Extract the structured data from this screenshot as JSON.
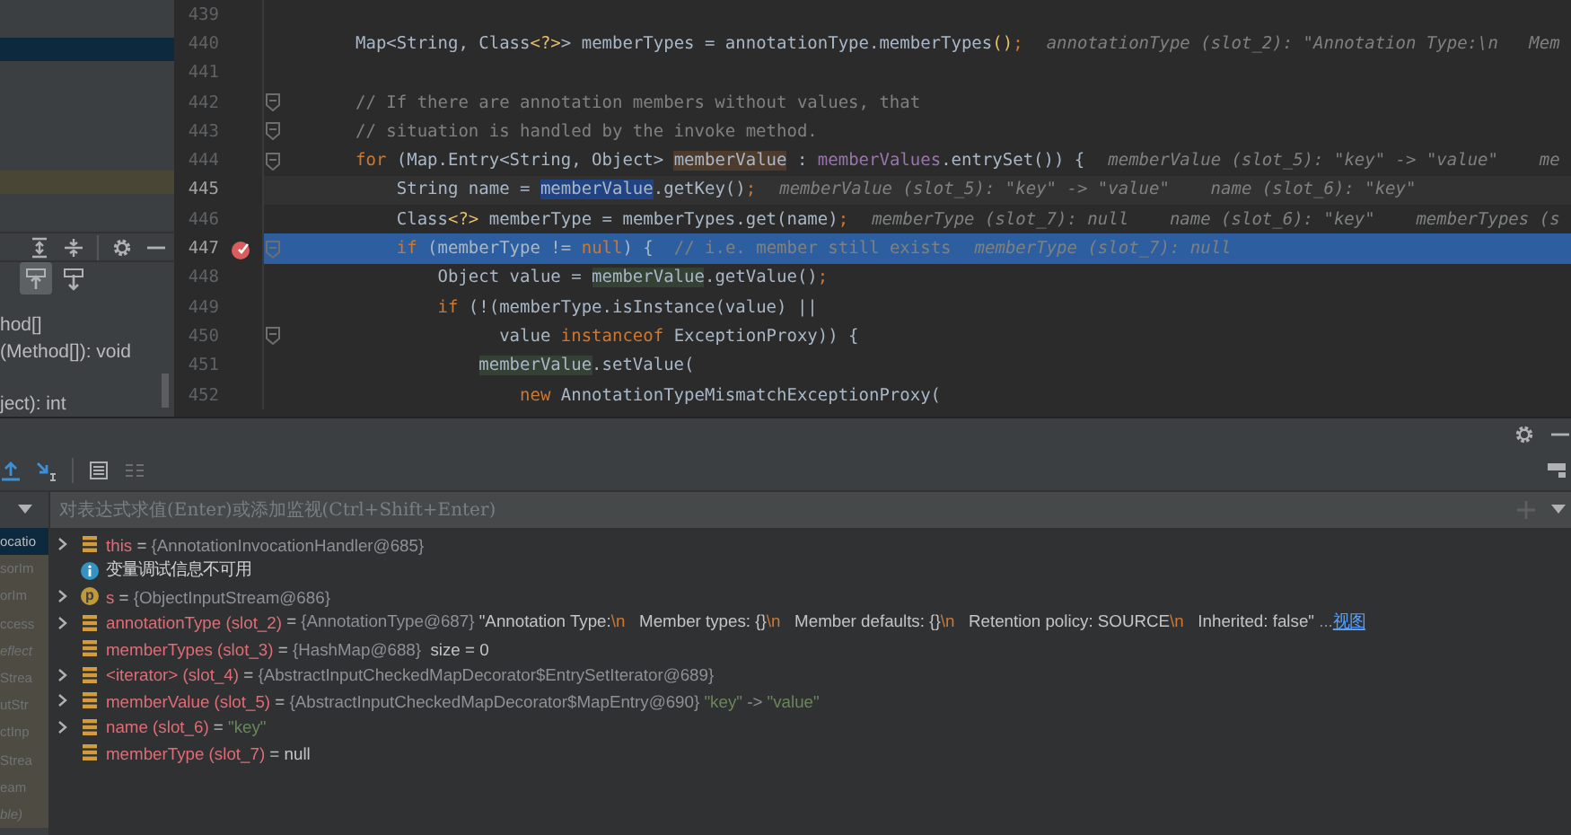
{
  "structure_panel": {
    "methods": [
      {
        "text": "hod[]"
      },
      {
        "text": "(Method[]): void"
      },
      {
        "text": "ject): int"
      }
    ]
  },
  "editor": {
    "lines": [
      {
        "number": "439",
        "breakpoint": false,
        "fold": false,
        "selected": false,
        "caret": false
      },
      {
        "number": "440",
        "breakpoint": false,
        "fold": false,
        "selected": false,
        "caret": false,
        "tokens": [
          {
            "text": "Map<String, Class",
            "kind": "plain"
          },
          {
            "text": "<?>",
            "kind": "paren"
          },
          {
            "text": "> memberTypes = annotationType.memberTypes",
            "kind": "plain"
          },
          {
            "text": "()",
            "kind": "paren"
          },
          {
            "text": ";",
            "kind": "keyword"
          }
        ],
        "hint": "annotationType (slot_2): \"Annotation Type:\\n   Mem"
      },
      {
        "number": "441",
        "breakpoint": false,
        "fold": false,
        "selected": false,
        "caret": false
      },
      {
        "number": "442",
        "breakpoint": false,
        "fold": true,
        "selected": false,
        "caret": false,
        "tokens": [
          {
            "text": "// If there are annotation members without values, that",
            "kind": "comment"
          }
        ]
      },
      {
        "number": "443",
        "breakpoint": false,
        "fold": true,
        "selected": false,
        "caret": false,
        "tokens": [
          {
            "text": "// situation is handled by the invoke method.",
            "kind": "comment"
          }
        ]
      },
      {
        "number": "444",
        "breakpoint": false,
        "fold": true,
        "selected": false,
        "caret": false,
        "tokens": [
          {
            "text": "for ",
            "kind": "keyword"
          },
          {
            "text": "(Map.Entry<String, Object> ",
            "kind": "plain"
          },
          {
            "text": "memberValue",
            "kind": "decl"
          },
          {
            "text": " : ",
            "kind": "plain"
          },
          {
            "text": "memberValues",
            "kind": "field"
          },
          {
            "text": ".entrySet()) {",
            "kind": "plain"
          }
        ],
        "hint": "memberValue (slot_5): \"key\" -> \"value\"    me"
      },
      {
        "number": "445",
        "breakpoint": false,
        "fold": false,
        "selected": false,
        "caret": true,
        "tokens": [
          {
            "text": "    String name = ",
            "kind": "plain"
          },
          {
            "text": "memberValue",
            "kind": "selection"
          },
          {
            "text": ".getKey()",
            "kind": "plain"
          },
          {
            "text": ";",
            "kind": "keyword"
          }
        ],
        "hint": "memberValue (slot_5): \"key\" -> \"value\"    name (slot_6): \"key\""
      },
      {
        "number": "446",
        "breakpoint": false,
        "fold": false,
        "selected": false,
        "caret": false,
        "tokens": [
          {
            "text": "    Class",
            "kind": "plain"
          },
          {
            "text": "<?>",
            "kind": "paren"
          },
          {
            "text": " memberType = memberTypes.get(name)",
            "kind": "plain"
          },
          {
            "text": ";",
            "kind": "keyword"
          }
        ],
        "hint": "memberType (slot_7): null    name (slot_6): \"key\"    memberTypes (s"
      },
      {
        "number": "447",
        "breakpoint": true,
        "fold": true,
        "selected": true,
        "caret": false,
        "tokens": [
          {
            "text": "    if ",
            "kind": "keyword"
          },
          {
            "text": "(memberType != ",
            "kind": "plain"
          },
          {
            "text": "null",
            "kind": "keyword"
          },
          {
            "text": ") {  ",
            "kind": "plain"
          },
          {
            "text": "// i.e. member still exists",
            "kind": "comment"
          }
        ],
        "hint": "memberType (slot_7): null"
      },
      {
        "number": "448",
        "breakpoint": false,
        "fold": false,
        "selected": false,
        "caret": false,
        "tokens": [
          {
            "text": "        Object value = ",
            "kind": "plain"
          },
          {
            "text": "memberValue",
            "kind": "usage"
          },
          {
            "text": ".getValue()",
            "kind": "plain"
          },
          {
            "text": ";",
            "kind": "keyword"
          }
        ]
      },
      {
        "number": "449",
        "breakpoint": false,
        "fold": false,
        "selected": false,
        "caret": false,
        "tokens": [
          {
            "text": "        if ",
            "kind": "keyword"
          },
          {
            "text": "(!(memberType.isInstance(value) ||",
            "kind": "plain"
          }
        ]
      },
      {
        "number": "450",
        "breakpoint": false,
        "fold": true,
        "selected": false,
        "caret": false,
        "tokens": [
          {
            "text": "              value ",
            "kind": "plain"
          },
          {
            "text": "instanceof ",
            "kind": "keyword"
          },
          {
            "text": "ExceptionProxy)) {",
            "kind": "plain"
          }
        ]
      },
      {
        "number": "451",
        "breakpoint": false,
        "fold": false,
        "selected": false,
        "caret": false,
        "tokens": [
          {
            "text": "            memberValue",
            "kind": "usage"
          },
          {
            "text": ".setValue(",
            "kind": "plain"
          }
        ]
      },
      {
        "number": "452",
        "breakpoint": false,
        "fold": false,
        "selected": false,
        "caret": false,
        "tokens": [
          {
            "text": "                new ",
            "kind": "keyword"
          },
          {
            "text": "AnnotationTypeMismatchExceptionProxy(",
            "kind": "plain"
          }
        ]
      }
    ]
  },
  "debugger": {
    "watch": {
      "placeholder": "对表达式求值(Enter)或添加监视(Ctrl+Shift+Enter)"
    },
    "frames": [
      {
        "text": "ocatio",
        "selected": true,
        "italic": false
      },
      {
        "text": "sorIm",
        "selected": false,
        "italic": false
      },
      {
        "text": "orIm",
        "selected": false,
        "italic": false
      },
      {
        "text": "ccess",
        "selected": false,
        "italic": false
      },
      {
        "text": "eflect",
        "selected": false,
        "italic": true
      },
      {
        "text": "Strea",
        "selected": false,
        "italic": false
      },
      {
        "text": "utStr",
        "selected": false,
        "italic": false
      },
      {
        "text": "ctInp",
        "selected": false,
        "italic": false
      },
      {
        "text": "Strea",
        "selected": false,
        "italic": false
      },
      {
        "text": "eam",
        "selected": false,
        "italic": false
      },
      {
        "text": "ble)",
        "selected": false,
        "italic": true
      }
    ],
    "variables": [
      {
        "kind": "field",
        "expandable": true,
        "name": "this",
        "value": [
          {
            "text": " = ",
            "kind": "plain"
          },
          {
            "text": "{AnnotationInvocationHandler@685}",
            "kind": "ref"
          }
        ]
      },
      {
        "kind": "message",
        "expandable": false,
        "name": "变量调试信息不可用"
      },
      {
        "kind": "param",
        "badge": "p",
        "expandable": true,
        "name": "s",
        "value": [
          {
            "text": " = ",
            "kind": "plain"
          },
          {
            "text": "{ObjectInputStream@686}",
            "kind": "ref"
          }
        ]
      },
      {
        "kind": "field",
        "expandable": true,
        "name": "annotationType (slot_2)",
        "value": [
          {
            "text": " = ",
            "kind": "plain"
          },
          {
            "text": "{AnnotationType@687} ",
            "kind": "ref"
          },
          {
            "text": "\"Annotation Type:",
            "kind": "text"
          },
          {
            "text": "\\n",
            "kind": "esc"
          },
          {
            "text": "   Member types: {}",
            "kind": "text"
          },
          {
            "text": "\\n",
            "kind": "esc"
          },
          {
            "text": "   Member defaults: {}",
            "kind": "text"
          },
          {
            "text": "\\n",
            "kind": "esc"
          },
          {
            "text": "   Retention policy: SOURCE",
            "kind": "text"
          },
          {
            "text": "\\n",
            "kind": "esc"
          },
          {
            "text": "   Inherited: false\"",
            "kind": "text"
          },
          {
            "text": " ...",
            "kind": "ref"
          },
          {
            "text": "视图",
            "kind": "link"
          }
        ]
      },
      {
        "kind": "field",
        "expandable": false,
        "name": "memberTypes (slot_3)",
        "value": [
          {
            "text": " = ",
            "kind": "plain"
          },
          {
            "text": "{HashMap@688} ",
            "kind": "ref"
          },
          {
            "text": " size = 0",
            "kind": "text"
          }
        ]
      },
      {
        "kind": "field",
        "expandable": true,
        "name": "<iterator> (slot_4)",
        "value": [
          {
            "text": " = ",
            "kind": "plain"
          },
          {
            "text": "{AbstractInputCheckedMapDecorator$EntrySetIterator@689}",
            "kind": "ref"
          }
        ]
      },
      {
        "kind": "field",
        "expandable": true,
        "name": "memberValue (slot_5)",
        "value": [
          {
            "text": " = ",
            "kind": "plain"
          },
          {
            "text": "{AbstractInputCheckedMapDecorator$MapEntry@690} ",
            "kind": "ref"
          },
          {
            "text": "\"key\"",
            "kind": "str"
          },
          {
            "text": " -> ",
            "kind": "ref"
          },
          {
            "text": "\"value\"",
            "kind": "str"
          }
        ]
      },
      {
        "kind": "field",
        "expandable": true,
        "name": "name (slot_6)",
        "value": [
          {
            "text": " = ",
            "kind": "plain"
          },
          {
            "text": "\"key\"",
            "kind": "str"
          }
        ]
      },
      {
        "kind": "field",
        "expandable": false,
        "name": "memberType (slot_7)",
        "value": [
          {
            "text": " = ",
            "kind": "plain"
          },
          {
            "text": "null",
            "kind": "text"
          }
        ]
      }
    ]
  }
}
